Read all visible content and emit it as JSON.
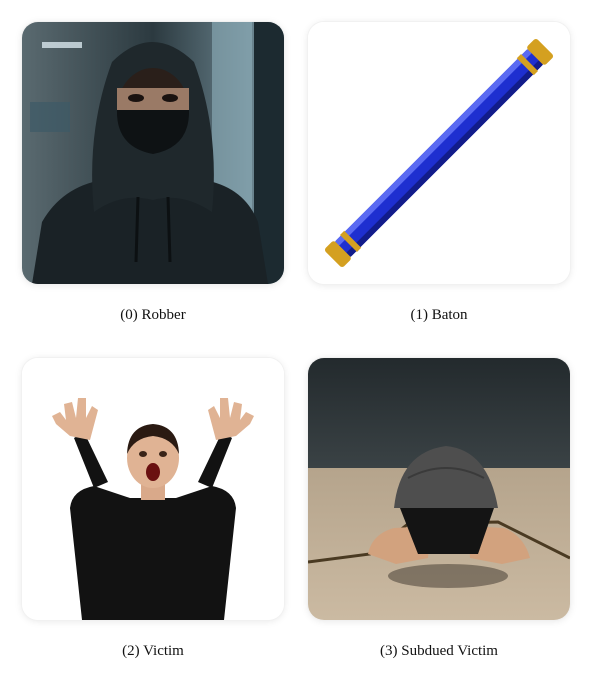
{
  "items": [
    {
      "index": 0,
      "caption": "(0) Robber",
      "image": "robber-photo"
    },
    {
      "index": 1,
      "caption": "(1) Baton",
      "image": "baton-illustration"
    },
    {
      "index": 2,
      "caption": "(2) Victim",
      "image": "victim-photo"
    },
    {
      "index": 3,
      "caption": "(3) Subdued Victim",
      "image": "subdued-victim-photo"
    }
  ],
  "colors": {
    "baton_body": "#1e2fd0",
    "baton_gold": "#d4a020",
    "hoodie": "#1a2226",
    "background": "#ffffff"
  }
}
